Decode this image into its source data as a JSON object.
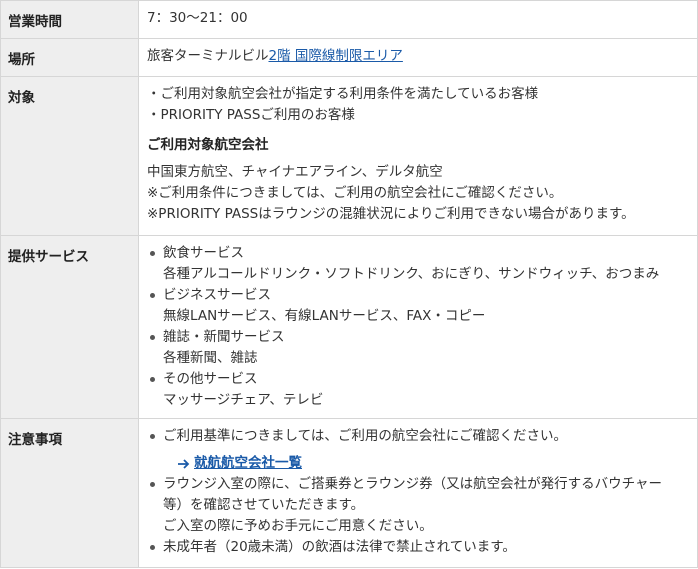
{
  "hours": {
    "label": "営業時間",
    "value": "7：30〜21：00"
  },
  "place": {
    "label": "場所",
    "text": "旅客ターミナルビル",
    "link_text": "2階 国際線制限エリア"
  },
  "target": {
    "label": "対象",
    "lines": [
      "・ご利用対象航空会社が指定する利用条件を満たしているお客様",
      "・PRIORITY PASSご利用のお客様"
    ],
    "airlines_heading": "ご利用対象航空会社",
    "airlines_lines": [
      "中国東方航空、チャイナエアライン、デルタ航空",
      "※ご利用条件につきましては、ご利用の航空会社にご確認ください。",
      "※PRIORITY PASSはラウンジの混雑状況によりご利用できない場合があります。"
    ]
  },
  "services": {
    "label": "提供サービス",
    "items": [
      {
        "title": "飲食サービス",
        "detail": "各種アルコールドリンク・ソフトドリンク、おにぎり、サンドウィッチ、おつまみ"
      },
      {
        "title": "ビジネスサービス",
        "detail": "無線LANサービス、有線LANサービス、FAX・コピー"
      },
      {
        "title": "雑誌・新聞サービス",
        "detail": "各種新聞、雑誌"
      },
      {
        "title": "その他サービス",
        "detail": "マッサージチェア、テレビ"
      }
    ]
  },
  "notes": {
    "label": "注意事項",
    "item1": "ご利用基準につきましては、ご利用の航空会社にご確認ください。",
    "airline_link": "就航航空会社一覧",
    "item2_line1": "ラウンジ入室の際に、ご搭乗券とラウンジ券（又は航空会社が発行するバウチャー",
    "item2_line2": "等）を確認させていただきます。",
    "item2_line3": "ご入室の際に予めお手元にご用意ください。",
    "item3": "未成年者（20歳未満）の飲酒は法律で禁止されています。"
  },
  "colors": {
    "label_bg": "#eeeeee",
    "border": "#d6d6d6",
    "link": "#1a5aa8",
    "text": "#333333"
  },
  "icons": {
    "link_arrow": "arrow-right-icon"
  }
}
